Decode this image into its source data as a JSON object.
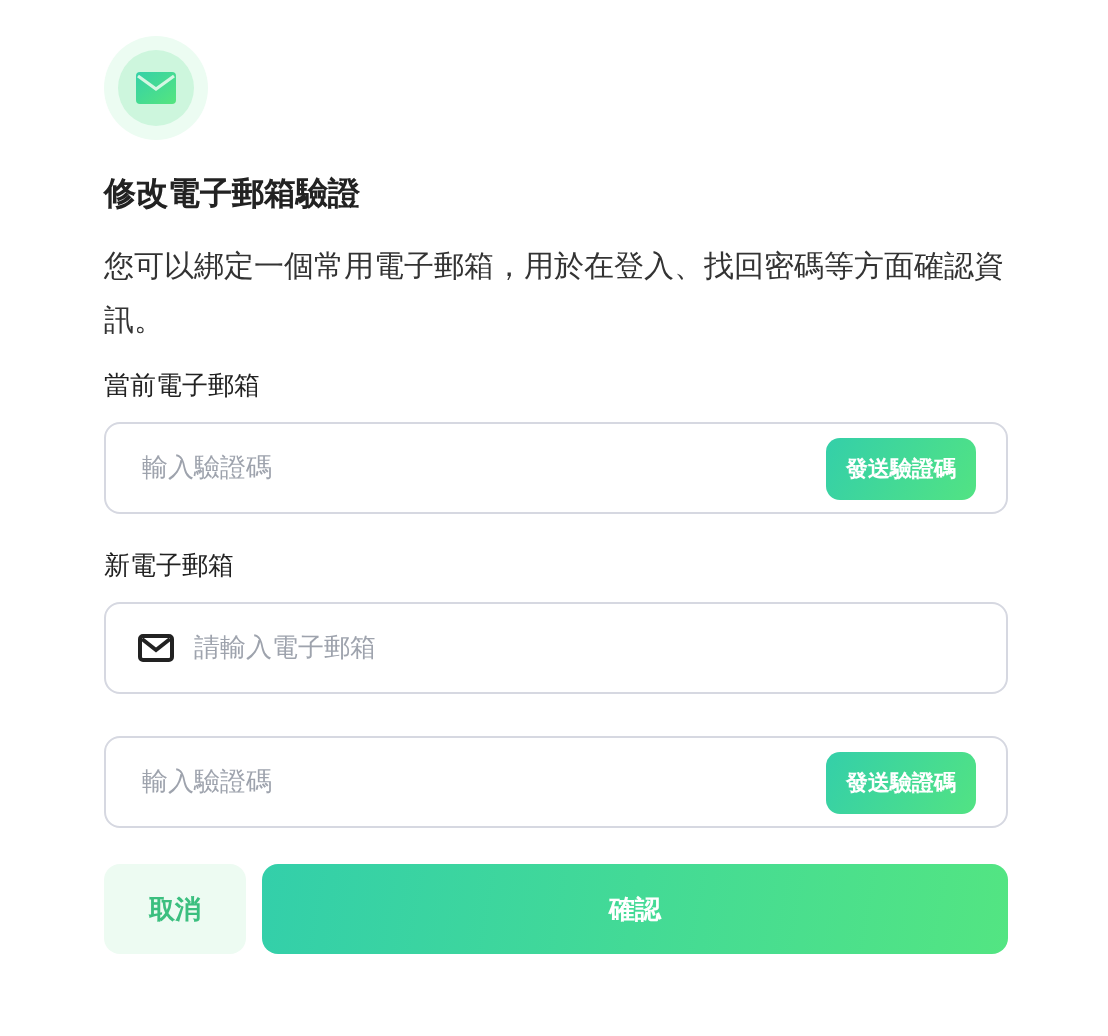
{
  "title": "修改電子郵箱驗證",
  "description": "您可以綁定一個常用電子郵箱，用於在登入、找回密碼等方面確認資訊。",
  "fields": [
    {
      "kind": "code",
      "label": "當前電子郵箱",
      "placeholder": "輸入驗證碼",
      "button": "發送驗證碼"
    },
    {
      "kind": "email",
      "label": "新電子郵箱",
      "placeholder": "請輸入電子郵箱"
    },
    {
      "kind": "code",
      "placeholder": "輸入驗證碼",
      "button": "發送驗證碼"
    }
  ],
  "buttons": {
    "cancel": "取消",
    "confirm": "確認"
  }
}
